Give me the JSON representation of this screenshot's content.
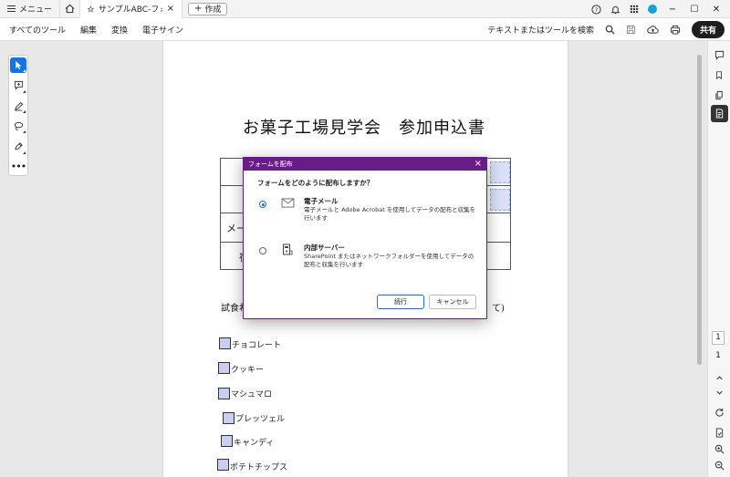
{
  "tabbar": {
    "menu_label": "メニュー",
    "tab_title": "サンプルABC-フォーム...",
    "create_label": "作成"
  },
  "toolbar": {
    "items": [
      "すべてのツール",
      "編集",
      "変換",
      "電子サイン"
    ],
    "search_label": "テキストまたはツールを検索",
    "share_label": "共有"
  },
  "document": {
    "title": "お菓子工場見学会　参加申込書",
    "row_label_1": "メー",
    "row_label_2": "宿",
    "tasting_note": "試食希",
    "tasting_note_end": "て)",
    "checkboxes": [
      "チョコレート",
      "クッキー",
      "マシュマロ",
      "プレッツェル",
      "キャンディ",
      "ポテトチップス"
    ]
  },
  "dialog": {
    "title": "フォームを配布",
    "question": "フォームをどのように配布しますか？",
    "options": [
      {
        "title": "電子メール",
        "desc": "電子メールと Adobe Acrobat を使用してデータの配布と収集を行います",
        "selected": true
      },
      {
        "title": "内部サーバー",
        "desc": "SharePoint またはネットワークフォルダーを使用してデータの配布と収集を行います",
        "selected": false
      }
    ],
    "continue_label": "続行",
    "cancel_label": "キャンセル"
  },
  "pager": {
    "current": "1",
    "total": "1"
  },
  "colors": {
    "accent": "#1473e6",
    "dialog_header": "#6a1b8a",
    "field_highlight": "#d9e0f7"
  }
}
